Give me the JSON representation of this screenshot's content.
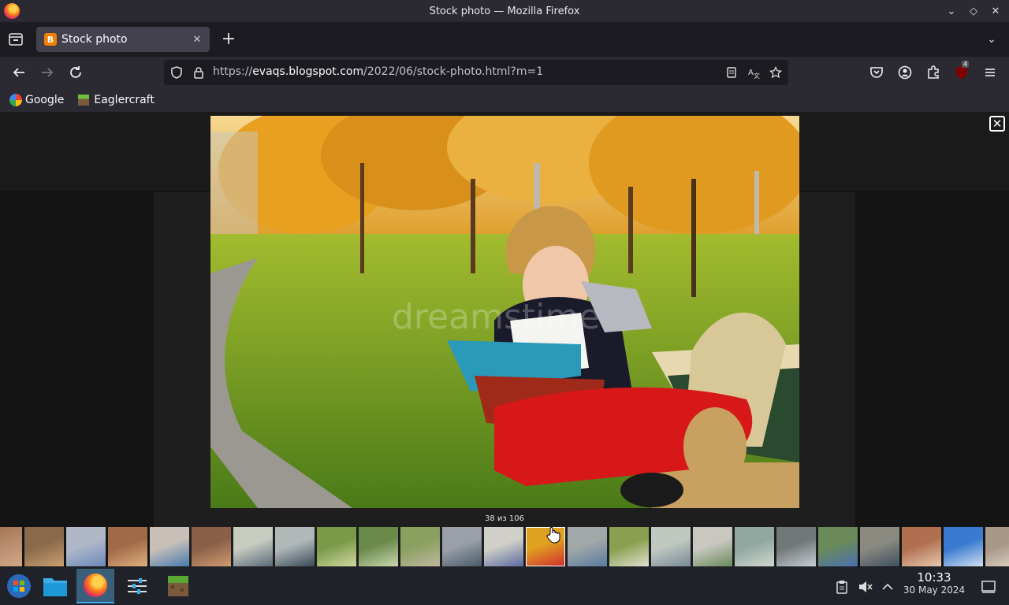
{
  "window": {
    "title": "Stock photo — Mozilla Firefox"
  },
  "tabs": [
    {
      "label": "Stock photo"
    }
  ],
  "urlbar": {
    "scheme": "https://",
    "host": "evaqs.blogspot.com",
    "path": "/2022/06/stock-photo.html?m=1"
  },
  "extensions": {
    "badge_count": "4"
  },
  "bookmarks": [
    {
      "label": "Google"
    },
    {
      "label": "Eaglercraft"
    }
  ],
  "lightbox": {
    "counter": "38 из 106",
    "active_index": 12
  },
  "thumbnails": [
    {
      "c1": "#8a6a4a",
      "c2": "#c9a070"
    },
    {
      "c1": "#b0b8c8",
      "c2": "#6a88b8"
    },
    {
      "c1": "#a06a48",
      "c2": "#e0b080"
    },
    {
      "c1": "#c8c0b8",
      "c2": "#4a7ab0"
    },
    {
      "c1": "#8a6048",
      "c2": "#d09a70"
    },
    {
      "c1": "#c8ccc0",
      "c2": "#5a6a7a"
    },
    {
      "c1": "#b0b8b8",
      "c2": "#3a4a5a"
    },
    {
      "c1": "#7a9a4a",
      "c2": "#d0d8a0"
    },
    {
      "c1": "#6a8a4a",
      "c2": "#c8d8b0"
    },
    {
      "c1": "#8aa060",
      "c2": "#c0b8a0"
    },
    {
      "c1": "#9aa0a8",
      "c2": "#4a5a6a"
    },
    {
      "c1": "#d0d0c8",
      "c2": "#5a6aa0"
    },
    {
      "c1": "#e0a020",
      "c2": "#d03030"
    },
    {
      "c1": "#a0a8a8",
      "c2": "#5a7aa0"
    },
    {
      "c1": "#8aa050",
      "c2": "#e0e0d0"
    },
    {
      "c1": "#c0c8c0",
      "c2": "#7a8a9a"
    },
    {
      "c1": "#c8c8c0",
      "c2": "#6a8a5a"
    },
    {
      "c1": "#90a8a0",
      "c2": "#d0d8d0"
    },
    {
      "c1": "#707878",
      "c2": "#c8d0d8"
    },
    {
      "c1": "#6a8a5a",
      "c2": "#4a70b0"
    },
    {
      "c1": "#8a8a80",
      "c2": "#405060"
    },
    {
      "c1": "#b07050",
      "c2": "#e8c8b0"
    },
    {
      "c1": "#3a7ad0",
      "c2": "#d0e0f0"
    },
    {
      "c1": "#a89888",
      "c2": "#e0d8c8"
    },
    {
      "c1": "#707070",
      "c2": "#c03030"
    }
  ],
  "taskbar": {
    "time": "10:33",
    "date": "30 May 2024"
  },
  "colors": {
    "chrome": "#2b2a33",
    "tab_active": "#42414d",
    "taskbar": "#1f2329",
    "accent": "#3daee9"
  }
}
